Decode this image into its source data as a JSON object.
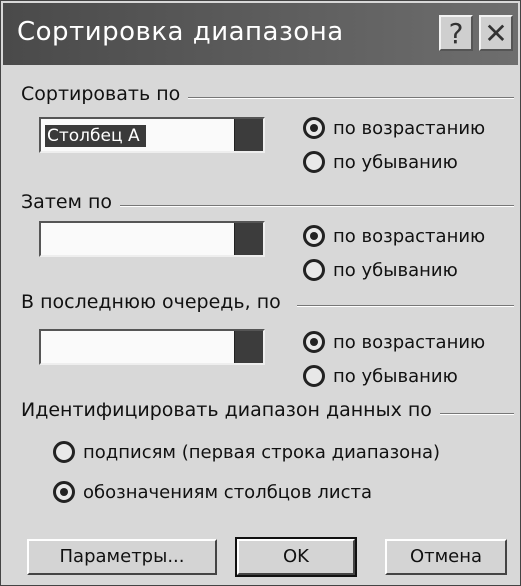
{
  "window": {
    "title": "Сортировка диапазона",
    "help": "?",
    "close": "✕"
  },
  "sort_by": {
    "label": "Сортировать по",
    "field": "Столбец А",
    "asc": "по возрастанию",
    "desc": "по убыванию",
    "selected": "asc"
  },
  "then_by": {
    "label": "Затем по",
    "field": "",
    "asc": "по возрастанию",
    "desc": "по убыванию",
    "selected": "asc"
  },
  "last_by": {
    "label": "В последнюю очередь, по",
    "field": "",
    "asc": "по возрастанию",
    "desc": "по убыванию",
    "selected": "asc"
  },
  "identify": {
    "label": "Идентифицировать диапазон данных по",
    "opt_labels": "подписям (первая строка диапазона)",
    "opt_columns": "обозначениям столбцов листа",
    "selected": "columns"
  },
  "buttons": {
    "params": "Параметры...",
    "ok": "OK",
    "cancel": "Отмена"
  }
}
